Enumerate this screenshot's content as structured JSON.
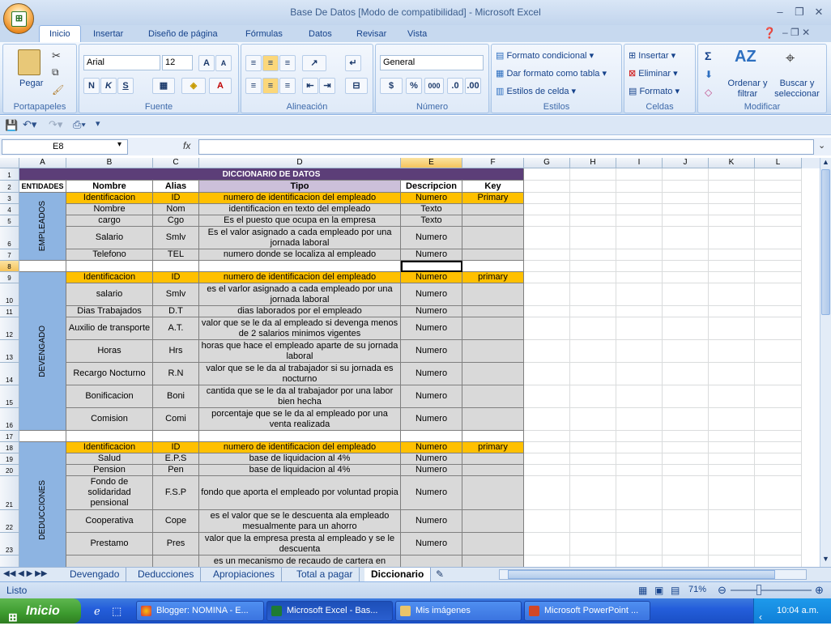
{
  "window": {
    "title": "Base De Datos  [Modo de compatibilidad] - Microsoft Excel"
  },
  "tabs": [
    "Inicio",
    "Insertar",
    "Diseño de página",
    "Fórmulas",
    "Datos",
    "Revisar",
    "Vista"
  ],
  "ribbon": {
    "portapapeles": {
      "label": "Portapapeles",
      "pegar": "Pegar"
    },
    "fuente": {
      "label": "Fuente",
      "font": "Arial",
      "size": "12",
      "bold": "N",
      "italic": "K",
      "underline": "S"
    },
    "alineacion": {
      "label": "Alineación"
    },
    "numero": {
      "label": "Número",
      "format": "General",
      "currency": "$",
      "percent": "%",
      "thousands": "000"
    },
    "estilos": {
      "label": "Estilos",
      "cond": "Formato condicional",
      "tabla": "Dar formato como tabla",
      "celda": "Estilos de celda"
    },
    "celdas": {
      "label": "Celdas",
      "insertar": "Insertar",
      "eliminar": "Eliminar",
      "formato": "Formato"
    },
    "modificar": {
      "label": "Modificar",
      "sigma": "Σ",
      "ordenar": "Ordenar y filtrar",
      "buscar": "Buscar y seleccionar"
    }
  },
  "formula_bar": {
    "name_box": "E8",
    "fx": "fx",
    "content": ""
  },
  "columns": [
    "A",
    "B",
    "C",
    "D",
    "E",
    "F",
    "G",
    "H",
    "I",
    "J",
    "K",
    "L"
  ],
  "sheet": {
    "title": "DICCIONARIO DE DATOS",
    "headers": [
      "ENTIDADES",
      "Nombre",
      "Alias",
      "Tipo",
      "Descripcion",
      "Key"
    ],
    "groups": [
      "EMPLEADOS",
      "DEVENGADO",
      "DEDUCCIONES"
    ],
    "rows": [
      {
        "n": "3",
        "name": "Identificacion",
        "alias": "ID",
        "tipo": "numero de identificacion del empleado",
        "desc": "Numero",
        "key": "Primary"
      },
      {
        "n": "4",
        "name": "Nombre",
        "alias": "Nom",
        "tipo": "identificacion en texto del empleado",
        "desc": "Texto",
        "key": ""
      },
      {
        "n": "5",
        "name": "cargo",
        "alias": "Cgo",
        "tipo": "Es el puesto que ocupa en la empresa",
        "desc": "Texto",
        "key": ""
      },
      {
        "n": "6",
        "name": "Salario",
        "alias": "Smlv",
        "tipo": "Es el valor asignado a cada empleado por una jornada laboral",
        "desc": "Numero",
        "key": ""
      },
      {
        "n": "7",
        "name": "Telefono",
        "alias": "TEL",
        "tipo": "numero donde se localiza al empleado",
        "desc": "Numero",
        "key": ""
      },
      {
        "n": "9",
        "name": "Identificacion",
        "alias": "ID",
        "tipo": "numero de identificacion del empleado",
        "desc": "Numero",
        "key": "primary"
      },
      {
        "n": "10",
        "name": "salario",
        "alias": "Smlv",
        "tipo": "es el varlor asignado a cada empleado por una jornada laboral",
        "desc": "Numero",
        "key": ""
      },
      {
        "n": "11",
        "name": "Dias Trabajados",
        "alias": "D.T",
        "tipo": "dias laborados por el empleado",
        "desc": "Numero",
        "key": ""
      },
      {
        "n": "12",
        "name": "Auxilio de transporte",
        "alias": "A.T.",
        "tipo": "valor que se le da al empleado si devenga menos de 2 salarios minimos vigentes",
        "desc": "Numero",
        "key": ""
      },
      {
        "n": "13",
        "name": "Horas",
        "alias": "Hrs",
        "tipo": "horas que hace el empleado aparte de su jornada laboral",
        "desc": "Numero",
        "key": ""
      },
      {
        "n": "14",
        "name": "Recargo Nocturno",
        "alias": "R.N",
        "tipo": "valor que se le da al trabajador si su jornada es nocturno",
        "desc": "Numero",
        "key": ""
      },
      {
        "n": "15",
        "name": "Bonificacion",
        "alias": "Boni",
        "tipo": "cantida que se le da al trabajador por una labor bien hecha",
        "desc": "Numero",
        "key": ""
      },
      {
        "n": "16",
        "name": "Comision",
        "alias": "Comi",
        "tipo": "porcentaje que se le da al empleado por una venta realizada",
        "desc": "Numero",
        "key": ""
      },
      {
        "n": "18",
        "name": "Identificacion",
        "alias": "ID",
        "tipo": "numero de identificacion del empleado",
        "desc": "Numero",
        "key": "primary"
      },
      {
        "n": "19",
        "name": "Salud",
        "alias": "E.P.S",
        "tipo": "base de liquidacion al 4%",
        "desc": "Numero",
        "key": ""
      },
      {
        "n": "20",
        "name": "Pension",
        "alias": "Pen",
        "tipo": "base de liquidacion al 4%",
        "desc": "Numero",
        "key": ""
      },
      {
        "n": "21",
        "name": "Fondo de solidaridad pensional",
        "alias": "F.S.P",
        "tipo": "fondo que aporta el empleado por voluntad propia",
        "desc": "Numero",
        "key": ""
      },
      {
        "n": "22",
        "name": "Cooperativa",
        "alias": "Cope",
        "tipo": "es el valor que se le descuenta ala empleado mesualmente para un ahorro",
        "desc": "Numero",
        "key": ""
      },
      {
        "n": "23",
        "name": "Prestamo",
        "alias": "Pres",
        "tipo": "valor que la empresa presta al empleado y se le descuenta",
        "desc": "Numero",
        "key": ""
      },
      {
        "n": "",
        "name": "",
        "alias": "",
        "tipo": "es un mecanismo de recaudo de cartera en donde",
        "desc": "",
        "key": ""
      }
    ],
    "row_numbers": [
      "1",
      "2",
      "8",
      "17"
    ]
  },
  "sheet_tabs": [
    "Devengado",
    "Deducciones",
    "Apropiaciones",
    "Total a pagar",
    "Diccionario"
  ],
  "status": {
    "ready": "Listo",
    "zoom": "71%"
  },
  "taskbar": {
    "start": "Inicio",
    "items": [
      "Blogger: NOMINA - E...",
      "Microsoft Excel - Bas...",
      "Mis imágenes",
      "Microsoft PowerPoint ..."
    ],
    "clock": "10:04 a.m."
  },
  "colors": {
    "header_purple": "#5c3e78",
    "orange": "#ffc000",
    "lavender": "#ccc0da",
    "gray": "#d9d9d9",
    "blue_group": "#8db4e2"
  }
}
